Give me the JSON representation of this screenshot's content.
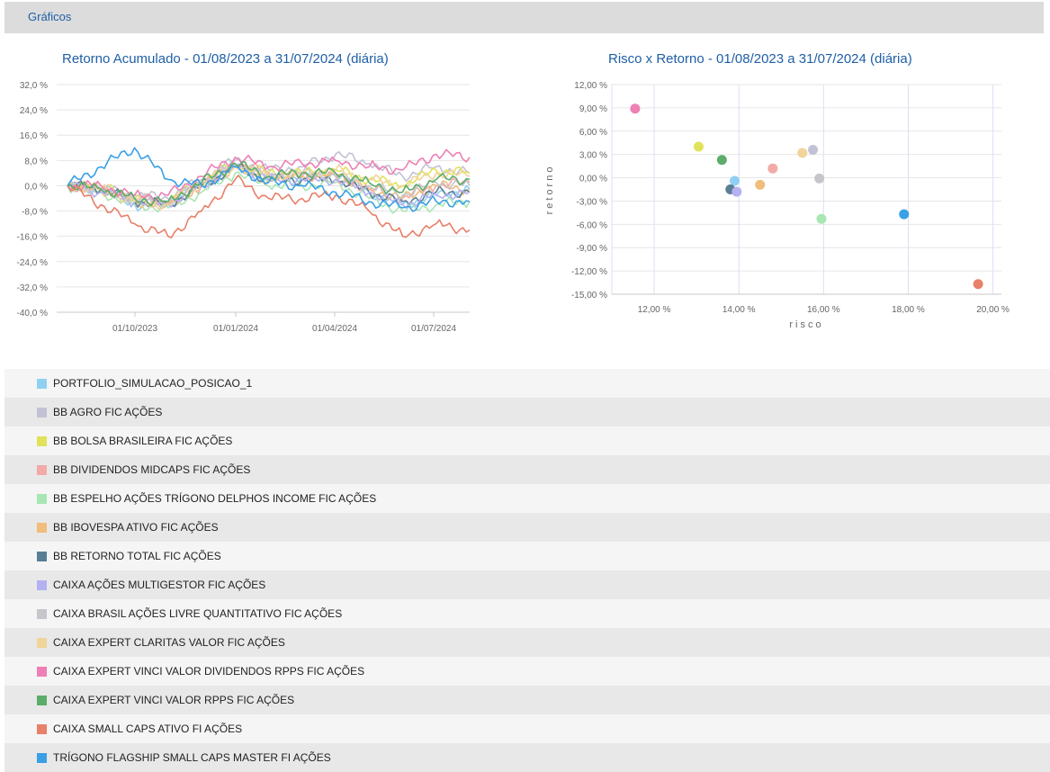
{
  "header": {
    "title": "Gráficos"
  },
  "legend": [
    {
      "label": "PORTFOLIO_SIMULACAO_POSICAO_1",
      "color": "#8fd0f2"
    },
    {
      "label": "BB AGRO FIC AÇÕES",
      "color": "#c2c2d6"
    },
    {
      "label": "BB BOLSA BRASILEIRA FIC AÇÕES",
      "color": "#e0e35a"
    },
    {
      "label": "BB DIVIDENDOS MIDCAPS FIC AÇÕES",
      "color": "#f3aaa6"
    },
    {
      "label": "BB ESPELHO AÇÕES TRÍGONO DELPHOS INCOME FIC AÇÕES",
      "color": "#a8e6b4"
    },
    {
      "label": "BB IBOVESPA ATIVO FIC AÇÕES",
      "color": "#f0bd7c"
    },
    {
      "label": "BB RETORNO TOTAL FIC AÇÕES",
      "color": "#5a7f95"
    },
    {
      "label": "CAIXA AÇÕES MULTIGESTOR FIC AÇÕES",
      "color": "#b4b0f2"
    },
    {
      "label": "CAIXA BRASIL AÇÕES LIVRE QUANTITATIVO FIC AÇÕES",
      "color": "#c6c6cc"
    },
    {
      "label": "CAIXA EXPERT CLARITAS VALOR FIC AÇÕES",
      "color": "#f0d49a"
    },
    {
      "label": "CAIXA EXPERT VINCI VALOR DIVIDENDOS RPPS FIC AÇÕES",
      "color": "#ee80b4"
    },
    {
      "label": "CAIXA EXPERT VINCI VALOR RPPS FIC AÇÕES",
      "color": "#5cad6a"
    },
    {
      "label": "CAIXA SMALL CAPS ATIVO FI AÇÕES",
      "color": "#e8806a"
    },
    {
      "label": "TRÍGONO FLAGSHIP SMALL CAPS MASTER FI AÇÕES",
      "color": "#3aa0e6"
    }
  ],
  "chart_data": [
    {
      "type": "line",
      "title": "Retorno Acumulado - 01/08/2023 a 31/07/2024 (diária)",
      "ylim": [
        -40,
        32
      ],
      "yticks": [
        "32,0 %",
        "24,0 %",
        "16,0 %",
        "8,0 %",
        "0,0 %",
        "-8,0 %",
        "-16,0 %",
        "-24,0 %",
        "-32,0 %",
        "-40,0 %"
      ],
      "xticks": [
        "01/10/2023",
        "01/01/2024",
        "01/04/2024",
        "01/07/2024"
      ],
      "x": [
        "01/08/2023",
        "01/09/2023",
        "01/10/2023",
        "01/11/2023",
        "01/12/2023",
        "01/01/2024",
        "01/02/2024",
        "01/03/2024",
        "01/04/2024",
        "01/05/2024",
        "01/06/2024",
        "01/07/2024",
        "31/07/2024"
      ],
      "series": [
        {
          "name": "PORTFOLIO_SIMULACAO_POSICAO_1",
          "values": [
            0,
            -2,
            -6,
            -6,
            0,
            6,
            2,
            3,
            4,
            -2,
            -6,
            -3,
            -1
          ]
        },
        {
          "name": "BB AGRO FIC AÇÕES",
          "values": [
            0,
            -1,
            -3,
            -4,
            2,
            8,
            5,
            6,
            10,
            7,
            3,
            6,
            4
          ]
        },
        {
          "name": "BB BOLSA BRASILEIRA FIC AÇÕES",
          "values": [
            0,
            0,
            -4,
            -5,
            1,
            7,
            4,
            4,
            5,
            2,
            0,
            5,
            4
          ]
        },
        {
          "name": "BB DIVIDENDOS MIDCAPS FIC AÇÕES",
          "values": [
            0,
            -1,
            -4,
            -6,
            0,
            7,
            4,
            3,
            3,
            -1,
            -4,
            0,
            1
          ]
        },
        {
          "name": "BB ESPELHO AÇÕES TRÍGONO DELPHOS INCOME FIC AÇÕES",
          "values": [
            0,
            -2,
            -6,
            -7,
            -2,
            4,
            0,
            0,
            1,
            -4,
            -8,
            -6,
            -5
          ]
        },
        {
          "name": "BB IBOVESPA ATIVO FIC AÇÕES",
          "values": [
            0,
            -1,
            -5,
            -6,
            0,
            6,
            2,
            3,
            3,
            -1,
            -4,
            0,
            -1
          ]
        },
        {
          "name": "BB RETORNO TOTAL FIC AÇÕES",
          "values": [
            0,
            -1,
            -5,
            -6,
            0,
            6,
            2,
            2,
            2,
            -2,
            -5,
            -2,
            -2
          ]
        },
        {
          "name": "CAIXA AÇÕES MULTIGESTOR FIC AÇÕES",
          "values": [
            0,
            -2,
            -5,
            -6,
            0,
            6,
            2,
            2,
            2,
            -2,
            -6,
            -3,
            -2
          ]
        },
        {
          "name": "CAIXA BRASIL AÇÕES LIVRE QUANTITATIVO FIC AÇÕES",
          "values": [
            0,
            -1,
            -4,
            -5,
            1,
            7,
            3,
            4,
            3,
            0,
            -3,
            1,
            0
          ]
        },
        {
          "name": "CAIXA EXPERT CLARITAS VALOR FIC AÇÕES",
          "values": [
            0,
            -1,
            -5,
            -6,
            1,
            6,
            3,
            4,
            5,
            2,
            0,
            4,
            3
          ]
        },
        {
          "name": "CAIXA EXPERT VINCI VALOR DIVIDENDOS RPPS FIC AÇÕES",
          "values": [
            0,
            0,
            -3,
            -3,
            3,
            9,
            6,
            7,
            8,
            6,
            5,
            10,
            9
          ]
        },
        {
          "name": "CAIXA EXPERT VINCI VALOR RPPS FIC AÇÕES",
          "values": [
            0,
            -1,
            -4,
            -5,
            1,
            7,
            3,
            4,
            4,
            1,
            -2,
            2,
            2
          ]
        },
        {
          "name": "CAIXA SMALL CAPS ATIVO FI AÇÕES",
          "values": [
            0,
            -6,
            -12,
            -16,
            -8,
            2,
            -4,
            -4,
            -3,
            -8,
            -16,
            -12,
            -14
          ]
        },
        {
          "name": "TRÍGONO FLAGSHIP SMALL CAPS MASTER FI AÇÕES",
          "values": [
            0,
            6,
            12,
            2,
            0,
            6,
            1,
            0,
            -2,
            -5,
            -7,
            -5,
            -5
          ]
        }
      ]
    },
    {
      "type": "scatter",
      "title": "Risco x Retorno - 01/08/2023 a 31/07/2024 (diária)",
      "xlabel": "risco",
      "ylabel": "retorno",
      "xlim": [
        11,
        20.2
      ],
      "ylim": [
        -15,
        12
      ],
      "xticks": [
        {
          "v": 12,
          "label": "12,00 %"
        },
        {
          "v": 14,
          "label": "14,00 %"
        },
        {
          "v": 16,
          "label": "16,00 %"
        },
        {
          "v": 18,
          "label": "18,00 %"
        },
        {
          "v": 20,
          "label": "20,00 %"
        }
      ],
      "yticks": [
        {
          "v": 12,
          "label": "12,00 %"
        },
        {
          "v": 9,
          "label": "9,00 %"
        },
        {
          "v": 6,
          "label": "6,00 %"
        },
        {
          "v": 3,
          "label": "3,00 %"
        },
        {
          "v": 0,
          "label": "0,00 %"
        },
        {
          "v": -3,
          "label": "-3,00 %"
        },
        {
          "v": -6,
          "label": "-6,00 %"
        },
        {
          "v": -9,
          "label": "-9,00 %"
        },
        {
          "v": -12,
          "label": "-12,00 %"
        },
        {
          "v": -15,
          "label": "-15,00 %"
        }
      ],
      "points": [
        {
          "name": "PORTFOLIO_SIMULACAO_POSICAO_1",
          "x": 13.9,
          "y": -0.4
        },
        {
          "name": "BB AGRO FIC AÇÕES",
          "x": 15.75,
          "y": 3.6
        },
        {
          "name": "BB BOLSA BRASILEIRA FIC AÇÕES",
          "x": 13.05,
          "y": 4.0
        },
        {
          "name": "BB DIVIDENDOS MIDCAPS FIC AÇÕES",
          "x": 14.8,
          "y": 1.2
        },
        {
          "name": "BB ESPELHO AÇÕES TRÍGONO DELPHOS INCOME FIC AÇÕES",
          "x": 15.95,
          "y": -5.3
        },
        {
          "name": "BB IBOVESPA ATIVO FIC AÇÕES",
          "x": 14.5,
          "y": -0.9
        },
        {
          "name": "BB RETORNO TOTAL FIC AÇÕES",
          "x": 13.8,
          "y": -1.5
        },
        {
          "name": "CAIXA AÇÕES MULTIGESTOR FIC AÇÕES",
          "x": 13.95,
          "y": -1.8
        },
        {
          "name": "CAIXA BRASIL AÇÕES LIVRE QUANTITATIVO FIC AÇÕES",
          "x": 15.9,
          "y": -0.1
        },
        {
          "name": "CAIXA EXPERT CLARITAS VALOR FIC AÇÕES",
          "x": 15.5,
          "y": 3.2
        },
        {
          "name": "CAIXA EXPERT VINCI VALOR DIVIDENDOS RPPS FIC AÇÕES",
          "x": 11.55,
          "y": 8.9
        },
        {
          "name": "CAIXA EXPERT VINCI VALOR RPPS FIC AÇÕES",
          "x": 13.6,
          "y": 2.3
        },
        {
          "name": "CAIXA SMALL CAPS ATIVO FI AÇÕES",
          "x": 19.65,
          "y": -13.7
        },
        {
          "name": "TRÍGONO FLAGSHIP SMALL CAPS MASTER FI AÇÕES",
          "x": 17.9,
          "y": -4.7
        }
      ]
    }
  ]
}
